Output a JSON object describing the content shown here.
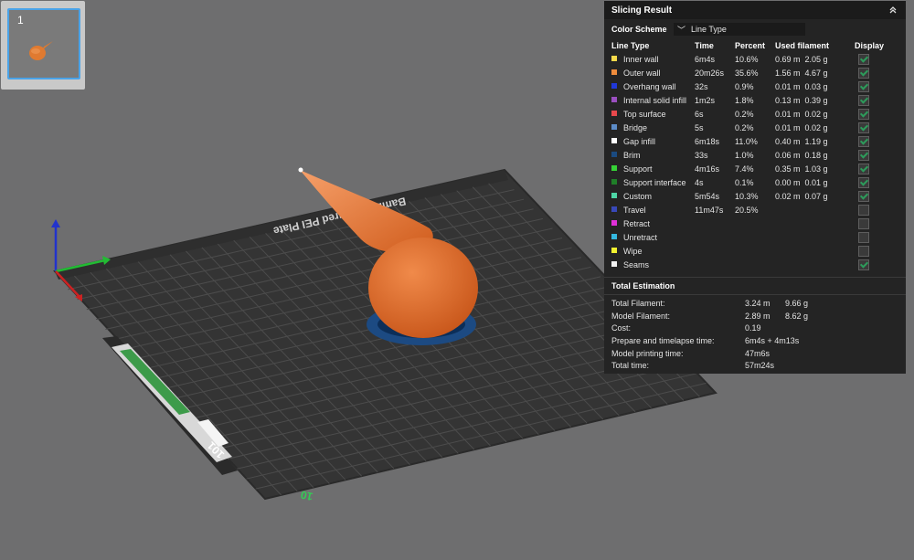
{
  "plate_thumb": {
    "number": "1"
  },
  "bed": {
    "brand_label": "Bambu Textured PEI Plate",
    "corner_tag": "10",
    "counter_label": "101"
  },
  "panel": {
    "title": "Slicing Result",
    "color_scheme_label": "Color Scheme",
    "color_scheme_value": "Line Type",
    "columns": [
      "Line Type",
      "Time",
      "Percent",
      "Used filament",
      "Display"
    ],
    "rows": [
      {
        "name": "Inner wall",
        "color": "#f5d94a",
        "time": "6m4s",
        "percent": "10.6%",
        "len": "0.69 m",
        "wt": "2.05 g",
        "on": true
      },
      {
        "name": "Outer wall",
        "color": "#ef8c3c",
        "time": "20m26s",
        "percent": "35.6%",
        "len": "1.56 m",
        "wt": "4.67 g",
        "on": true
      },
      {
        "name": "Overhang wall",
        "color": "#2038d8",
        "time": "32s",
        "percent": "0.9%",
        "len": "0.01 m",
        "wt": "0.03 g",
        "on": true
      },
      {
        "name": "Internal solid infill",
        "color": "#9a4fc0",
        "time": "1m2s",
        "percent": "1.8%",
        "len": "0.13 m",
        "wt": "0.39 g",
        "on": true
      },
      {
        "name": "Top surface",
        "color": "#e8484c",
        "time": "6s",
        "percent": "0.2%",
        "len": "0.01 m",
        "wt": "0.02 g",
        "on": true
      },
      {
        "name": "Bridge",
        "color": "#5c8cc8",
        "time": "5s",
        "percent": "0.2%",
        "len": "0.01 m",
        "wt": "0.02 g",
        "on": true
      },
      {
        "name": "Gap infill",
        "color": "#ffffff",
        "time": "6m18s",
        "percent": "11.0%",
        "len": "0.40 m",
        "wt": "1.19 g",
        "on": true
      },
      {
        "name": "Brim",
        "color": "#1a4a80",
        "time": "33s",
        "percent": "1.0%",
        "len": "0.06 m",
        "wt": "0.18 g",
        "on": true
      },
      {
        "name": "Support",
        "color": "#36d236",
        "time": "4m16s",
        "percent": "7.4%",
        "len": "0.35 m",
        "wt": "1.03 g",
        "on": true
      },
      {
        "name": "Support interface",
        "color": "#1f7f28",
        "time": "4s",
        "percent": "0.1%",
        "len": "0.00 m",
        "wt": "0.01 g",
        "on": true
      },
      {
        "name": "Custom",
        "color": "#4ed6a6",
        "time": "5m54s",
        "percent": "10.3%",
        "len": "0.02 m",
        "wt": "0.07 g",
        "on": true
      },
      {
        "name": "Travel",
        "color": "#3848b8",
        "time": "11m47s",
        "percent": "20.5%",
        "len": "",
        "wt": "",
        "on": false
      },
      {
        "name": "Retract",
        "color": "#e030d8",
        "time": "",
        "percent": "",
        "len": "",
        "wt": "",
        "on": false
      },
      {
        "name": "Unretract",
        "color": "#34b8e0",
        "time": "",
        "percent": "",
        "len": "",
        "wt": "",
        "on": false
      },
      {
        "name": "Wipe",
        "color": "#f2f230",
        "time": "",
        "percent": "",
        "len": "",
        "wt": "",
        "on": false
      },
      {
        "name": "Seams",
        "color": "#f2f2f2",
        "time": "",
        "percent": "",
        "len": "",
        "wt": "",
        "on": true
      }
    ],
    "estimation_title": "Total Estimation",
    "estimation": [
      {
        "label": "Total Filament:",
        "v1": "3.24 m",
        "v2": "9.66 g"
      },
      {
        "label": "Model Filament:",
        "v1": "2.89 m",
        "v2": "8.62 g"
      },
      {
        "label": "Cost:",
        "v1": "0.19",
        "v2": ""
      },
      {
        "label": "Prepare and timelapse time:",
        "v1": "6m4s + 4m13s",
        "v2": ""
      },
      {
        "label": "Model printing time:",
        "v1": "47m6s",
        "v2": ""
      },
      {
        "label": "Total time:",
        "v1": "57m24s",
        "v2": ""
      }
    ]
  },
  "colors": {
    "model": "#de6a24",
    "bed": "#323232",
    "grid": "#4a4a4a",
    "brim": "#1c4a82",
    "selection": "#4aa3e8"
  }
}
